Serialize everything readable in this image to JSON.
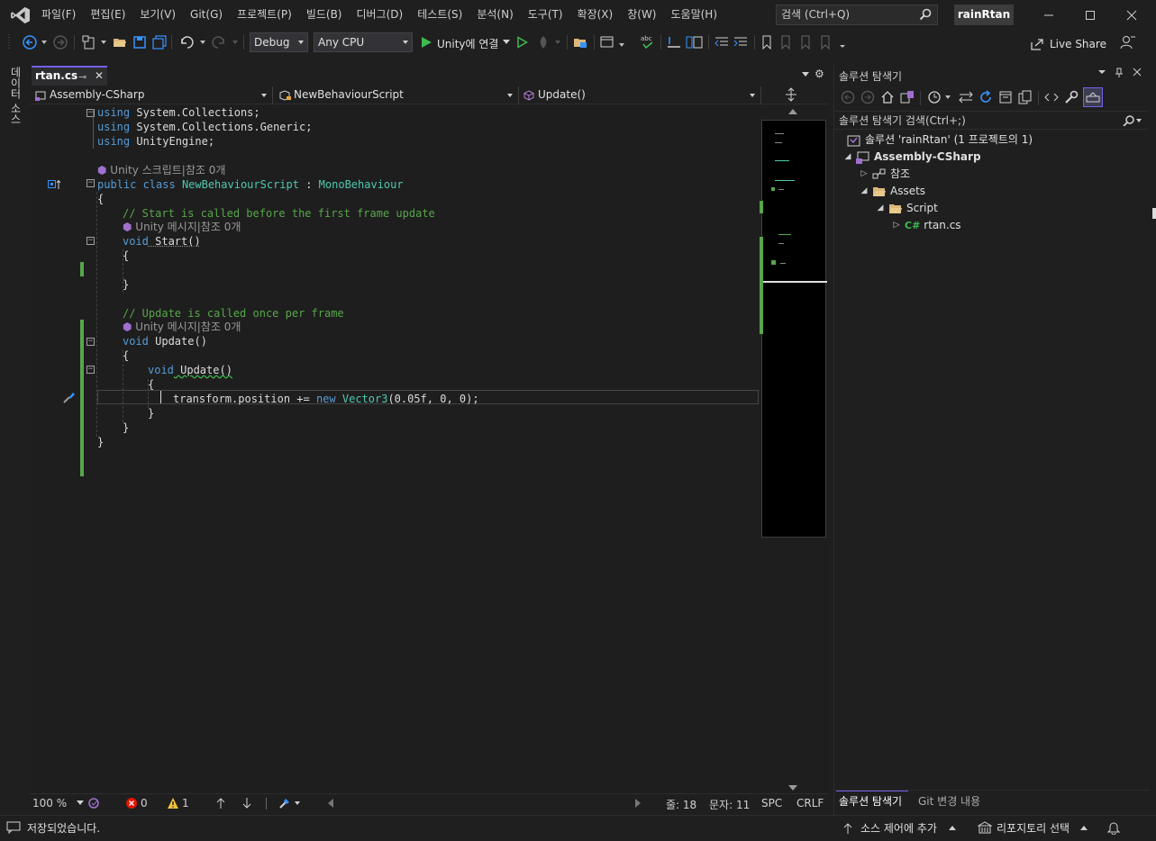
{
  "app": {
    "name": "Visual Studio",
    "solution_badge": "rainRtan"
  },
  "menu": [
    "파일(F)",
    "편집(E)",
    "보기(V)",
    "Git(G)",
    "프로젝트(P)",
    "빌드(B)",
    "디버그(D)",
    "테스트(S)",
    "분석(N)",
    "도구(T)",
    "확장(X)",
    "창(W)",
    "도움말(H)"
  ],
  "search": {
    "placeholder": "검색 (Ctrl+Q)"
  },
  "toolbar": {
    "config": "Debug",
    "platform": "Any CPU",
    "run_label": "Unity에 연결",
    "live_share": "Live Share"
  },
  "left_strip": {
    "data_source": "데이터 소스"
  },
  "editor": {
    "tab": {
      "file": "rtan.cs"
    },
    "nav": {
      "project": "Assembly-CSharp",
      "class": "NewBehaviourScript",
      "member": "Update()"
    },
    "code": {
      "l1": "using",
      "l1b": " System.Collections;",
      "l2": "using",
      "l2b": " System.Collections.Generic;",
      "l3": "using",
      "l3b": " UnityEngine;",
      "lens_class": "Unity 스크립트|참조 0개",
      "l5a": "public",
      "l5b": " class ",
      "l5c": "NewBehaviourScript",
      "l5d": " : ",
      "l5e": "MonoBehaviour",
      "brace_open": "{",
      "brace_close": "}",
      "comment_start": "// Start is called before the first frame update",
      "lens_start": "Unity 메시지|참조 0개",
      "void_kw": "void",
      "start_name": " Start()",
      "comment_update": "// Update is called once per frame",
      "lens_update": "Unity 메시지|참조 0개",
      "update_name": " Update()",
      "inner_update_name": " Update()",
      "stmt_a": "transform.position += ",
      "stmt_new": "new",
      "stmt_type": " Vector3",
      "stmt_b": "(0.05f, 0, 0);"
    },
    "status": {
      "zoom": "100 %",
      "errors": "0",
      "warnings": "1",
      "line": "줄: 18",
      "col": "문자: 11",
      "spc": "SPC",
      "eol": "CRLF"
    }
  },
  "solution_explorer": {
    "title": "솔루션 탐색기",
    "search_placeholder": "솔루션 탐색기 검색(Ctrl+;)",
    "solution": "솔루션 'rainRtan' (1 프로젝트의 1)",
    "project": "Assembly-CSharp",
    "references": "참조",
    "assets": "Assets",
    "script": "Script",
    "file_badge": "C#",
    "file": "rtan.cs",
    "tabs": [
      "솔루션 탐색기",
      "Git 변경 내용"
    ]
  },
  "statusbar": {
    "message": "저장되었습니다.",
    "source_control": "소스 제어에 추가",
    "repository": "리포지토리 선택"
  },
  "colors": {
    "accent": "#7160e8",
    "keyword": "#569cd6",
    "type": "#4ec9b0",
    "comment": "#57a64a"
  }
}
